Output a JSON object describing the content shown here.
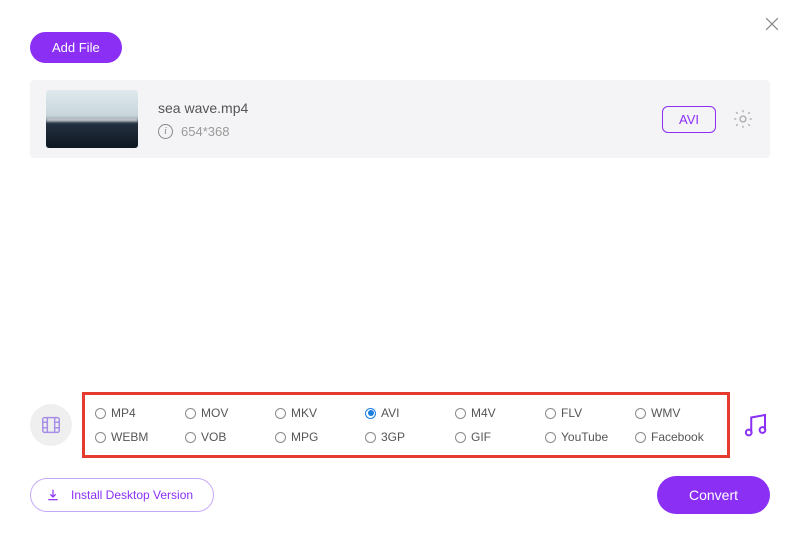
{
  "toolbar": {
    "add_file_label": "Add File"
  },
  "close_icon_name": "close",
  "file": {
    "name": "sea wave.mp4",
    "dimensions": "654*368",
    "target_format": "AVI"
  },
  "formats": {
    "selected": "AVI",
    "items": [
      "MP4",
      "MOV",
      "MKV",
      "AVI",
      "M4V",
      "FLV",
      "WMV",
      "WEBM",
      "VOB",
      "MPG",
      "3GP",
      "GIF",
      "YouTube",
      "Facebook"
    ]
  },
  "footer": {
    "install_label": "Install Desktop Version",
    "convert_label": "Convert"
  },
  "icons": {
    "film": "film-icon",
    "music": "music-icon",
    "gear": "gear-icon",
    "info": "info-icon",
    "download": "download-icon"
  },
  "colors": {
    "accent": "#8b2ff5",
    "highlight_border": "#e53b2f",
    "radio_selected": "#1a7de0"
  }
}
